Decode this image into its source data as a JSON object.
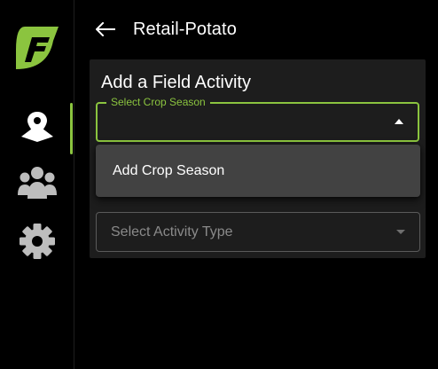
{
  "app": {
    "brand_icon": "agri-logo-icon",
    "accent_color": "#8bc43f"
  },
  "sidebar": {
    "items": [
      {
        "icon": "map-pin-icon",
        "active": true
      },
      {
        "icon": "team-icon",
        "active": false
      },
      {
        "icon": "gear-icon",
        "active": false
      }
    ]
  },
  "header": {
    "back_icon": "arrow-left-icon",
    "title": "Retail-Potato"
  },
  "panel": {
    "title": "Add a Field Activity",
    "crop_season": {
      "label": "Select Crop Season",
      "value": "",
      "state": "open"
    },
    "activity_type": {
      "placeholder": "Select Activity Type",
      "value": ""
    }
  },
  "dropdown": {
    "options": [
      {
        "label": "Add Crop Season"
      }
    ]
  }
}
